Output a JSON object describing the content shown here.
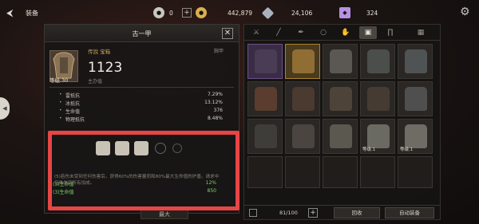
{
  "header": {
    "title": "装备",
    "currencies": [
      {
        "icon": "coin-icon",
        "value": "0",
        "color": "#c9c6c0"
      },
      {
        "icon": "gold-icon",
        "value": "442,879",
        "color": "#d8b04c"
      },
      {
        "icon": "crystal-icon",
        "value": "24,106",
        "color": "#a9b3bf"
      },
      {
        "icon": "gem-icon",
        "value": "324",
        "color": "#b691e3"
      }
    ]
  },
  "detail": {
    "title": "古一甲",
    "rarity_label": "传說 宝箱",
    "slot_label": "胸甲",
    "level_label": "等级.30",
    "power": "1123",
    "power_label": "主办值",
    "stats": [
      {
        "name": "雷抵抗",
        "value": "7.29%"
      },
      {
        "name": "冰抵抗",
        "value": "13.12%"
      },
      {
        "name": "生命值",
        "value": "376"
      },
      {
        "name": "物理抵抗",
        "value": "8.48%"
      }
    ],
    "set_effects": [
      {
        "label": "(3)生命值",
        "value": "12%"
      },
      {
        "label": "(3)生命值",
        "value": "850"
      }
    ],
    "set_description": "(5)若伤未受到任何伤害后，获得60%的伤害量而和80%最大生命值的护盾。请求中伍伤失后所有加成。",
    "bottom_buttons": [
      "",
      "",
      "最大",
      ""
    ]
  },
  "inventory": {
    "capacity": "81/100",
    "recycle_label": "回收",
    "auto_equip_label": "自动装备",
    "items": [
      {
        "rarity": "purple",
        "level": ""
      },
      {
        "rarity": "gold",
        "level": ""
      },
      {
        "rarity": "normal",
        "level": ""
      },
      {
        "rarity": "normal",
        "level": ""
      },
      {
        "rarity": "normal",
        "level": ""
      },
      {
        "rarity": "normal",
        "level": ""
      },
      {
        "rarity": "normal",
        "level": ""
      },
      {
        "rarity": "normal",
        "level": ""
      },
      {
        "rarity": "normal",
        "level": ""
      },
      {
        "rarity": "normal",
        "level": ""
      },
      {
        "rarity": "normal",
        "level": ""
      },
      {
        "rarity": "normal",
        "level": ""
      },
      {
        "rarity": "normal",
        "level": ""
      },
      {
        "rarity": "normal",
        "level": ""
      },
      {
        "rarity": "normal",
        "level": ""
      },
      {
        "rarity": "normal",
        "level": "等级.1"
      },
      {
        "rarity": "normal",
        "level": "等级.1"
      }
    ]
  }
}
